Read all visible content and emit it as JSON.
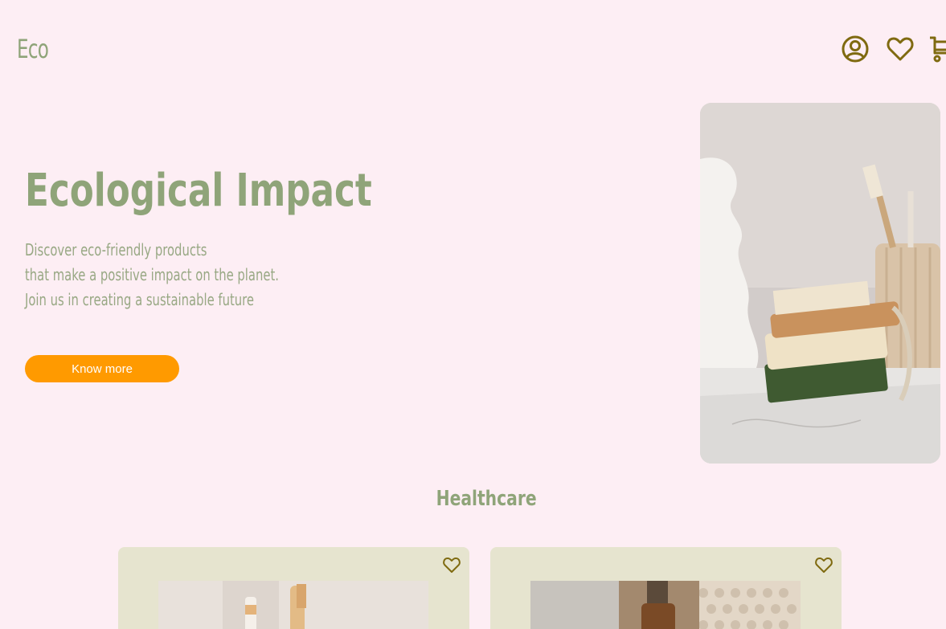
{
  "header": {
    "logo": "Eco",
    "icons": [
      "account-circle-icon",
      "heart-icon",
      "cart-icon"
    ]
  },
  "hero": {
    "title": "Ecological Impact",
    "lines": [
      "Discover eco-friendly products",
      "that make a positive impact on the planet.",
      "Join us in creating a sustainable future"
    ],
    "button_label": "Know more"
  },
  "section": {
    "title": "Healthcare"
  },
  "colors": {
    "background": "#fdeef4",
    "brand_green": "#8fa479",
    "accent_orange": "#ff9a00",
    "icon_olive": "#7f6a10",
    "card_bg": "#e6e4cf"
  }
}
